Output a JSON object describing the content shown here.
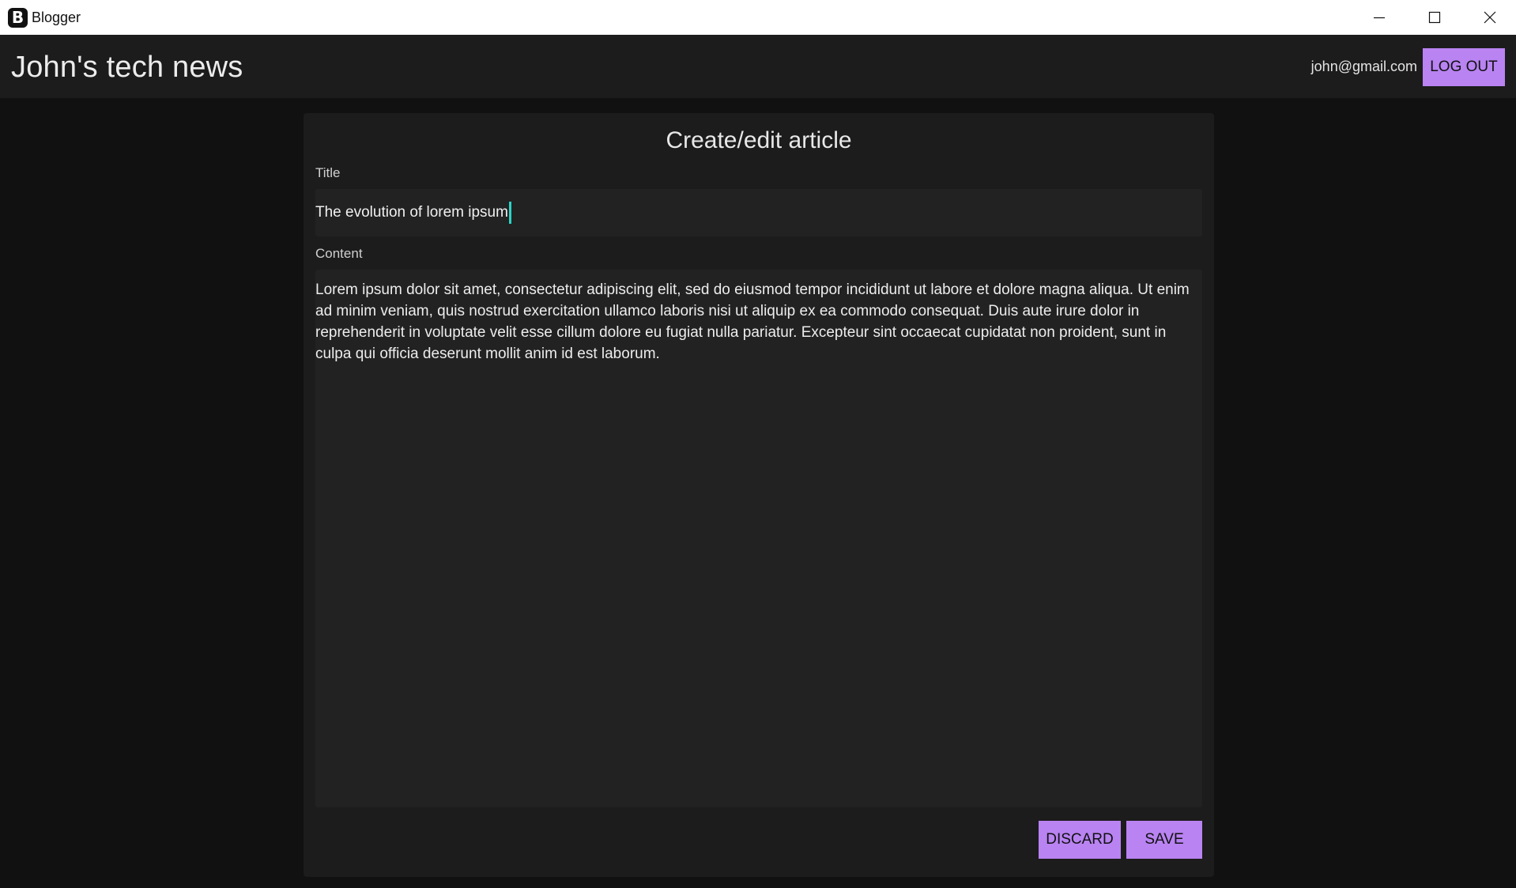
{
  "window": {
    "app_name": "Blogger",
    "logo_letter": "B"
  },
  "header": {
    "blog_title": "John's tech news",
    "user_email": "john@gmail.com",
    "logout_label": "LOG OUT"
  },
  "editor": {
    "heading": "Create/edit article",
    "title_label": "Title",
    "title_value": "The evolution of lorem ipsum",
    "content_label": "Content",
    "content_value": "Lorem ipsum dolor sit amet, consectetur adipiscing elit, sed do eiusmod tempor incididunt ut labore et dolore magna aliqua. Ut enim ad minim veniam, quis nostrud exercitation ullamco laboris nisi ut aliquip ex ea commodo consequat. Duis aute irure dolor in reprehenderit in voluptate velit esse cillum dolore eu fugiat nulla pariatur. Excepteur sint occaecat cupidatat non proident, sunt in culpa qui officia deserunt mollit anim id est laborum.",
    "discard_label": "DISCARD",
    "save_label": "SAVE"
  },
  "colors": {
    "accent": "#b983f2",
    "caret": "#2ad4c8",
    "background": "#111111",
    "surface": "#1c1c1c"
  },
  "icons": {
    "minimize": "minimize-icon",
    "maximize": "maximize-icon",
    "close": "close-icon"
  }
}
